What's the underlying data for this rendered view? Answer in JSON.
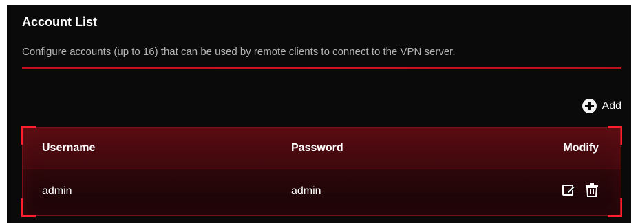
{
  "section": {
    "title": "Account List",
    "description": "Configure accounts (up to 16) that can be used by remote clients to connect to the VPN server."
  },
  "toolbar": {
    "add_label": "Add",
    "add_icon": "plus-circle-icon"
  },
  "table": {
    "columns": [
      "Username",
      "Password",
      "Modify"
    ],
    "rows": [
      {
        "username": "admin",
        "password": "admin",
        "actions": [
          "edit-icon",
          "delete-icon"
        ]
      }
    ]
  },
  "colors": {
    "background": "#0a0a0a",
    "accent": "#ff1e2d",
    "divider": "#c1101c",
    "text_primary": "#ffffff",
    "text_secondary": "#b5b5b5"
  }
}
